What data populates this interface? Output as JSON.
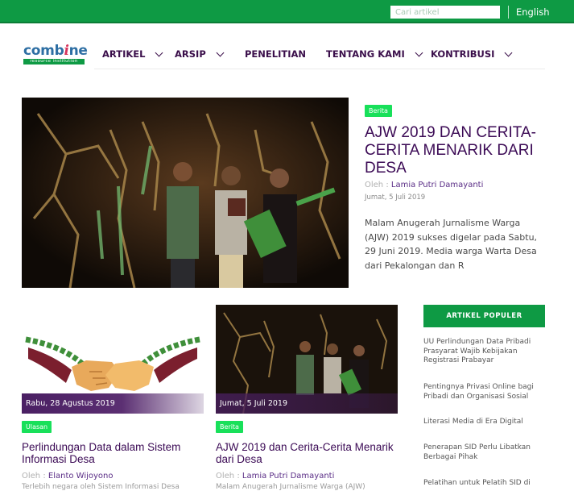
{
  "topbar": {
    "search_placeholder": "Cari artikel",
    "language_label": "English",
    "color": "#0e9a44"
  },
  "logo": {
    "word_start": "comb",
    "word_accent": "i",
    "word_end": "ne",
    "tagline": "resource institution"
  },
  "nav": {
    "items": [
      {
        "label": "ARTIKEL",
        "has_dropdown": true
      },
      {
        "label": "ARSIP",
        "has_dropdown": true
      },
      {
        "label": "PENELITIAN",
        "has_dropdown": false
      },
      {
        "label": "TENTANG KAMI",
        "has_dropdown": true
      },
      {
        "label": "KONTRIBUSI",
        "has_dropdown": true
      }
    ]
  },
  "featured": {
    "category": "Berita",
    "title": "AJW 2019 DAN CERITA-CERITA MENARIK DARI DESA",
    "by_prefix": "Oleh : ",
    "author": "Lamia Putri Damayanti",
    "date": "Jumat, 5 Juli 2019",
    "excerpt": "Malam Anugerah Jurnalisme Warga (AJW) 2019 sukses digelar pada Sabtu, 29 Juni 2019. Media warga Warta Desa dari Pekalongan dan R"
  },
  "cards": [
    {
      "date": "Rabu, 28 Agustus 2019",
      "category": "Ulasan",
      "title": "Perlindungan Data dalam Sistem Informasi Desa",
      "by_prefix": "Oleh : ",
      "author": "Elanto Wijoyono",
      "excerpt": "Terlebih negara oleh Sistem Informasi Desa"
    },
    {
      "date": "Jumat, 5 Juli 2019",
      "category": "Berita",
      "title": "AJW 2019 dan Cerita-Cerita Menarik dari Desa",
      "by_prefix": "Oleh : ",
      "author": "Lamia Putri Damayanti",
      "excerpt": "Malam Anugerah Jurnalisme Warga (AJW)"
    }
  ],
  "popular": {
    "header": "ARTIKEL POPULER",
    "items": [
      "UU Perlindungan Data Pribadi Prasyarat Wajib Kebijakan Registrasi Prabayar",
      "Pentingnya Privasi Online bagi Pribadi dan Organisasi Sosial",
      "Literasi Media di Era Digital",
      "Penerapan SID Perlu Libatkan Berbagai Pihak",
      "Pelatihan untuk Pelatih SID di"
    ]
  }
}
